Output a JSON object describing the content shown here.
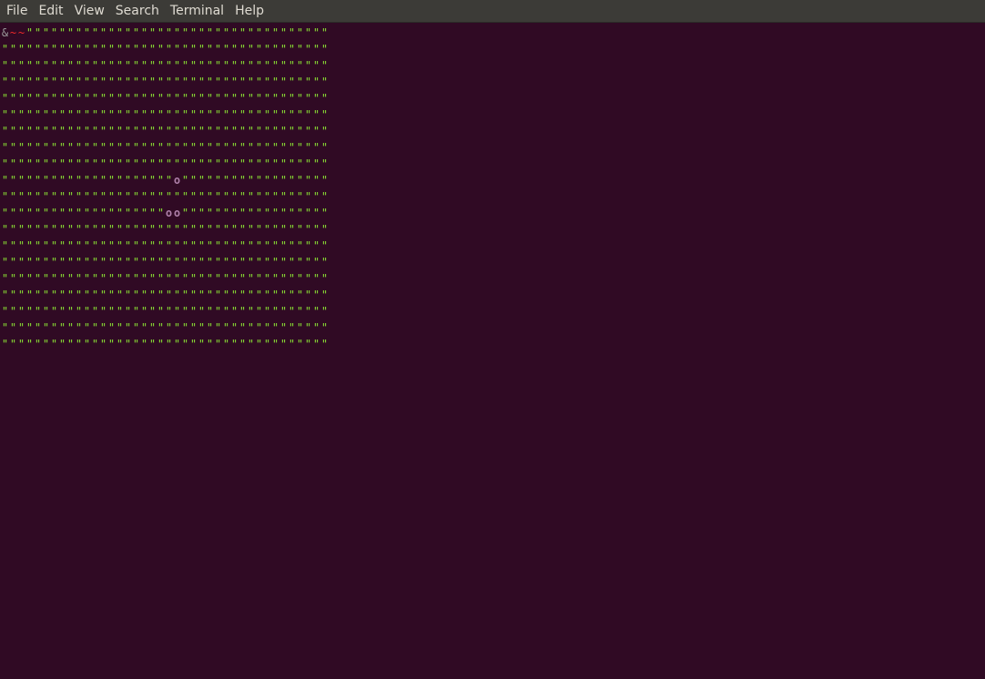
{
  "menubar": {
    "items": [
      {
        "id": "file",
        "label": "File"
      },
      {
        "id": "edit",
        "label": "Edit"
      },
      {
        "id": "view",
        "label": "View"
      },
      {
        "id": "search",
        "label": "Search"
      },
      {
        "id": "terminal",
        "label": "Terminal"
      },
      {
        "id": "help",
        "label": "Help"
      }
    ]
  },
  "colors": {
    "background": "#300a24",
    "menubar": "#3c3b37",
    "grass": "#8ae234",
    "player": "#9b9b9b",
    "tilde": "#ef2929",
    "stone": "#ad7fa8"
  },
  "terminal": {
    "rows": [
      "&~~\"\"\"\"\"\"\"\"\"\"\"\"\"\"\"\"\"\"\"\"\"\"\"\"\"\"\"\"\"\"\"\"\"\"\"\"\"",
      "\"\"\"\"\"\"\"\"\"\"\"\"\"\"\"\"\"\"\"\"\"\"\"\"\"\"\"\"\"\"\"\"\"\"\"\"\"\"\"\"",
      "\"\"\"\"\"\"\"\"\"\"\"\"\"\"\"\"\"\"\"\"\"\"\"\"\"\"\"\"\"\"\"\"\"\"\"\"\"\"\"\"",
      "\"\"\"\"\"\"\"\"\"\"\"\"\"\"\"\"\"\"\"\"\"\"\"\"\"\"\"\"\"\"\"\"\"\"\"\"\"\"\"\"",
      "\"\"\"\"\"\"\"\"\"\"\"\"\"\"\"\"\"\"\"\"\"\"\"\"\"\"\"\"\"\"\"\"\"\"\"\"\"\"\"\"",
      "\"\"\"\"\"\"\"\"\"\"\"\"\"\"\"\"\"\"\"\"\"\"\"\"\"\"\"\"\"\"\"\"\"\"\"\"\"\"\"\"",
      "\"\"\"\"\"\"\"\"\"\"\"\"\"\"\"\"\"\"\"\"\"\"\"\"\"\"\"\"\"\"\"\"\"\"\"\"\"\"\"\"",
      "\"\"\"\"\"\"\"\"\"\"\"\"\"\"\"\"\"\"\"\"\"\"\"\"\"\"\"\"\"\"\"\"\"\"\"\"\"\"\"\"",
      "\"\"\"\"\"\"\"\"\"\"\"\"\"\"\"\"\"\"\"\"\"\"\"\"\"\"\"\"\"\"\"\"\"\"\"\"\"\"\"\"",
      "\"\"\"\"\"\"\"\"\"\"\"\"\"\"\"\"\"\"\"\"\"o\"\"\"\"\"\"\"\"\"\"\"\"\"\"\"\"\"\"",
      "\"\"\"\"\"\"\"\"\"\"\"\"\"\"\"\"\"\"\"\"\"\"\"\"\"\"\"\"\"\"\"\"\"\"\"\"\"\"\"\"",
      "\"\"\"\"\"\"\"\"\"\"\"\"\"\"\"\"\"\"\"\"oo\"\"\"\"\"\"\"\"\"\"\"\"\"\"\"\"\"\"",
      "\"\"\"\"\"\"\"\"\"\"\"\"\"\"\"\"\"\"\"\"\"\"\"\"\"\"\"\"\"\"\"\"\"\"\"\"\"\"\"\"",
      "\"\"\"\"\"\"\"\"\"\"\"\"\"\"\"\"\"\"\"\"\"\"\"\"\"\"\"\"\"\"\"\"\"\"\"\"\"\"\"\"",
      "\"\"\"\"\"\"\"\"\"\"\"\"\"\"\"\"\"\"\"\"\"\"\"\"\"\"\"\"\"\"\"\"\"\"\"\"\"\"\"\"",
      "\"\"\"\"\"\"\"\"\"\"\"\"\"\"\"\"\"\"\"\"\"\"\"\"\"\"\"\"\"\"\"\"\"\"\"\"\"\"\"\"",
      "\"\"\"\"\"\"\"\"\"\"\"\"\"\"\"\"\"\"\"\"\"\"\"\"\"\"\"\"\"\"\"\"\"\"\"\"\"\"\"\"",
      "\"\"\"\"\"\"\"\"\"\"\"\"\"\"\"\"\"\"\"\"\"\"\"\"\"\"\"\"\"\"\"\"\"\"\"\"\"\"\"\"",
      "\"\"\"\"\"\"\"\"\"\"\"\"\"\"\"\"\"\"\"\"\"\"\"\"\"\"\"\"\"\"\"\"\"\"\"\"\"\"\"\"",
      "\"\"\"\"\"\"\"\"\"\"\"\"\"\"\"\"\"\"\"\"\"\"\"\"\"\"\"\"\"\"\"\"\"\"\"\"\"\"\"\""
    ]
  }
}
